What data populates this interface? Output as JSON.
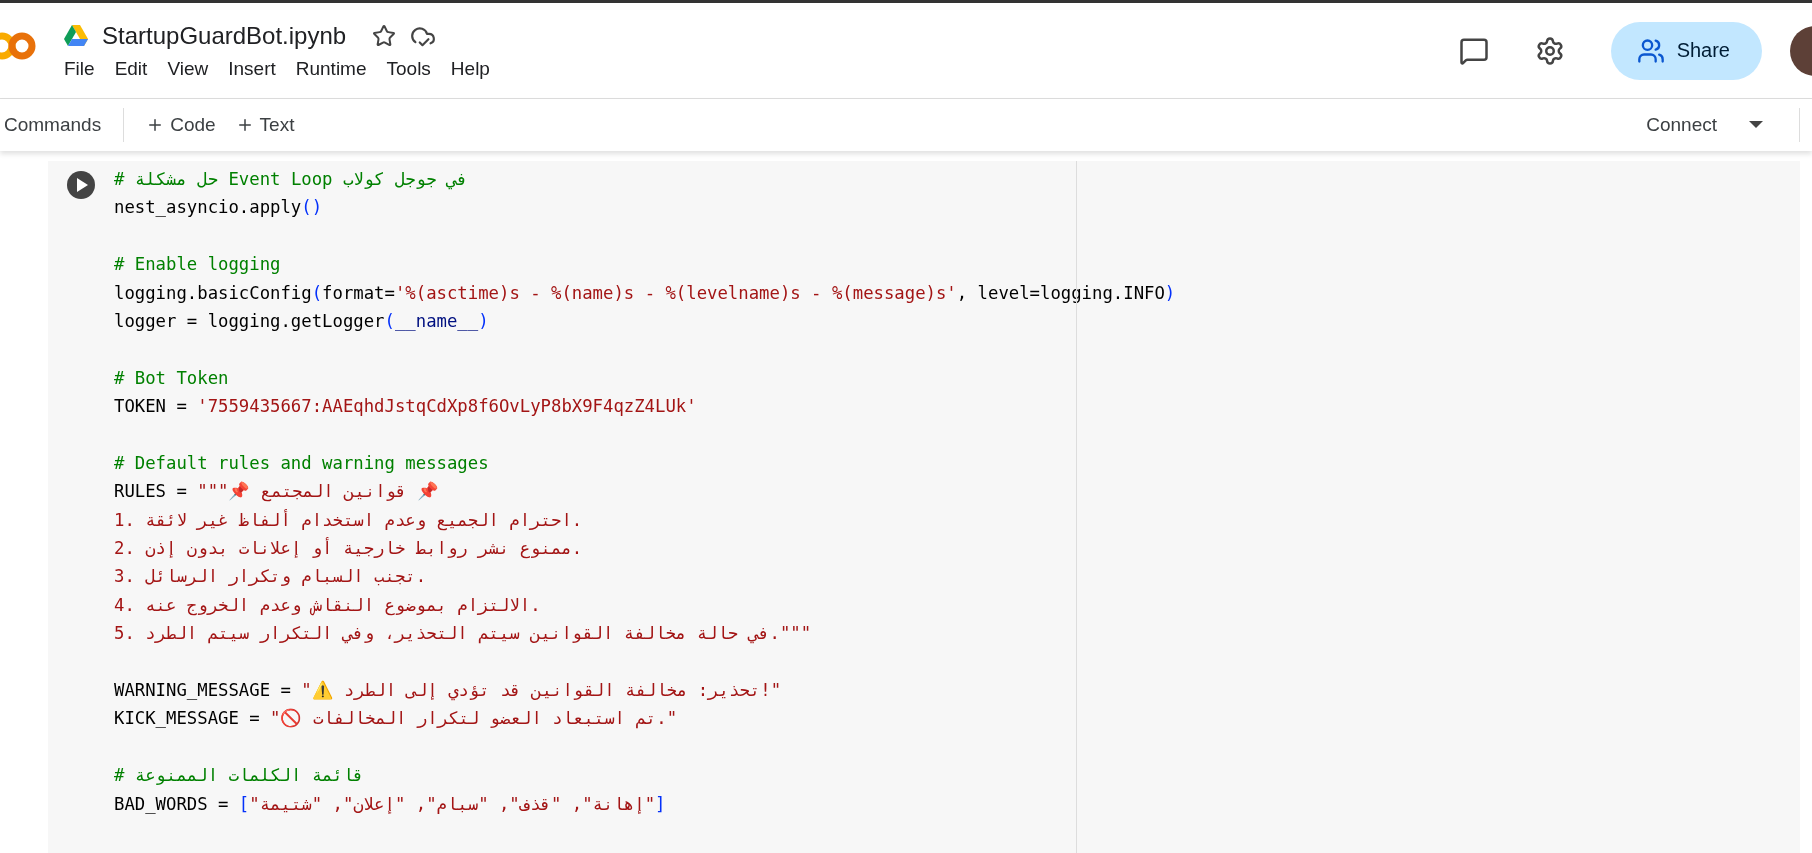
{
  "header": {
    "title": "StartupGuardBot.ipynb",
    "menu": [
      "File",
      "Edit",
      "View",
      "Insert",
      "Runtime",
      "Tools",
      "Help"
    ],
    "share_label": "Share"
  },
  "toolbar": {
    "commands": "Commands",
    "add_buttons": [
      "Code",
      "Text"
    ],
    "connect": "Connect"
  },
  "cell": {
    "blocks": [
      [
        [
          {
            "kind": "comment",
            "text": "# حل مشكلة Event Loop في جوجل كولاب"
          }
        ],
        [
          {
            "kind": "plain",
            "text": "nest_asyncio.apply"
          },
          {
            "kind": "bracket",
            "text": "()"
          }
        ]
      ],
      [
        [
          {
            "kind": "comment",
            "text": "# Enable logging"
          }
        ],
        [
          {
            "kind": "plain",
            "text": "logging.basicConfig"
          },
          {
            "kind": "bracket",
            "text": "("
          },
          {
            "kind": "plain",
            "text": "format="
          },
          {
            "kind": "string",
            "text": "'%(asctime)s - %(name)s - %(levelname)s - %(message)s'"
          },
          {
            "kind": "plain",
            "text": ", level=logging.INFO"
          },
          {
            "kind": "bracket",
            "text": ")"
          }
        ],
        [
          {
            "kind": "plain",
            "text": "logger = logging.getLogger"
          },
          {
            "kind": "bracket",
            "text": "("
          },
          {
            "kind": "name",
            "text": "__name__"
          },
          {
            "kind": "bracket",
            "text": ")"
          }
        ]
      ],
      [
        [
          {
            "kind": "comment",
            "text": "# Bot Token"
          }
        ],
        [
          {
            "kind": "plain",
            "text": "TOKEN = "
          },
          {
            "kind": "string",
            "text": "'7559435667:AAEqhdJstqCdXp8f6OvLyP8bX9F4qzZ4LUk'"
          }
        ]
      ],
      [
        [
          {
            "kind": "comment",
            "text": "# Default rules and warning messages"
          }
        ],
        [
          {
            "kind": "plain",
            "text": "RULES = "
          },
          {
            "kind": "string",
            "text": "\"\"\"📌 قوانين المجتمع 📌"
          }
        ],
        [
          {
            "kind": "string",
            "text": "1. احترام الجميع وعدم استخدام ألفاظ غير لائقة."
          }
        ],
        [
          {
            "kind": "string",
            "text": "2. ممنوع نشر روابط خارجية أو إعلانات بدون إذن."
          }
        ],
        [
          {
            "kind": "string",
            "text": "3. تجنب السبام وتكرار الرسائل."
          }
        ],
        [
          {
            "kind": "string",
            "text": "4. الالتزام بموضوع النقاش وعدم الخروج عنه."
          }
        ],
        [
          {
            "kind": "string",
            "text": "5. في حالة مخالفة القوانين سيتم التحذير، وفي التكرار سيتم الطرد.\"\"\""
          }
        ]
      ],
      [
        [
          {
            "kind": "plain",
            "text": "WARNING_MESSAGE = "
          },
          {
            "kind": "string",
            "text": "\"⚠️ تحذير: مخالفة القوانين قد تؤدي إلى الطرد!\""
          }
        ],
        [
          {
            "kind": "plain",
            "text": "KICK_MESSAGE = "
          },
          {
            "kind": "string",
            "text": "\"🚫 تم استبعاد العضو لتكرار المخالفات.\""
          }
        ]
      ],
      [
        [
          {
            "kind": "comment",
            "text": "# قائمة الكلمات الممنوعة"
          }
        ],
        [
          {
            "kind": "plain",
            "text": "BAD_WORDS = "
          },
          {
            "kind": "bracket",
            "text": "["
          },
          {
            "kind": "string",
            "text": "\"إهانة\", \"قذف\", \"سبام\", \"إعلان\", \"شتيمة\""
          },
          {
            "kind": "bracket",
            "text": "]"
          }
        ]
      ]
    ]
  }
}
